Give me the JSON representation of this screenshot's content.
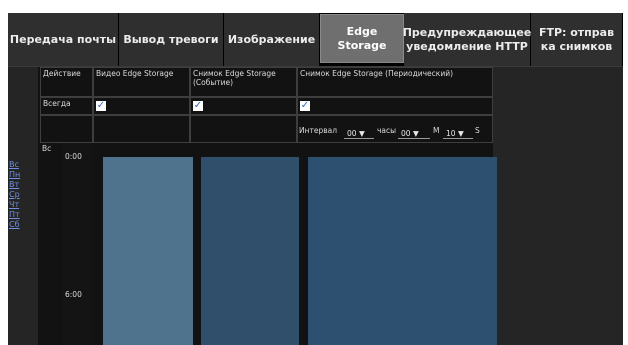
{
  "tabs": [
    {
      "label": "Передача почты",
      "active": false
    },
    {
      "label": "Вывод тревоги",
      "active": false
    },
    {
      "label": "Изображение",
      "active": false
    },
    {
      "label": "Edge Storage",
      "active": true
    },
    {
      "label": "Предупреждающее уведомление HTTP",
      "active": false
    },
    {
      "label": "FTP: отправ ка снимков",
      "active": false
    }
  ],
  "days": [
    "Вс",
    "Пн",
    "Вт",
    "Ср",
    "Чт",
    "Пт",
    "Сб"
  ],
  "table": {
    "header_action": "Действие",
    "columns": [
      "Видео Edge Storage",
      "Снимок Edge Storage (Событие)",
      "Снимок Edge Storage (Периодический)"
    ],
    "row_always": "Всегда",
    "always_checked": [
      true,
      true,
      true
    ],
    "interval": {
      "label": "Интервал",
      "hours_value": "00",
      "hours_label": "часы",
      "minutes_value": "00",
      "minutes_label": "М",
      "seconds_value": "10",
      "seconds_label": "S"
    }
  },
  "schedule": {
    "day_label": "Вс",
    "times": [
      "0:00",
      "6:00"
    ],
    "colors": {
      "video": "#4f728d",
      "event": "#2f4f6b",
      "periodic": "#2e5070",
      "tabs_bg": "#2f2f2f",
      "tab_active": "#6f6f6f",
      "link": "#6f8fe0"
    }
  }
}
